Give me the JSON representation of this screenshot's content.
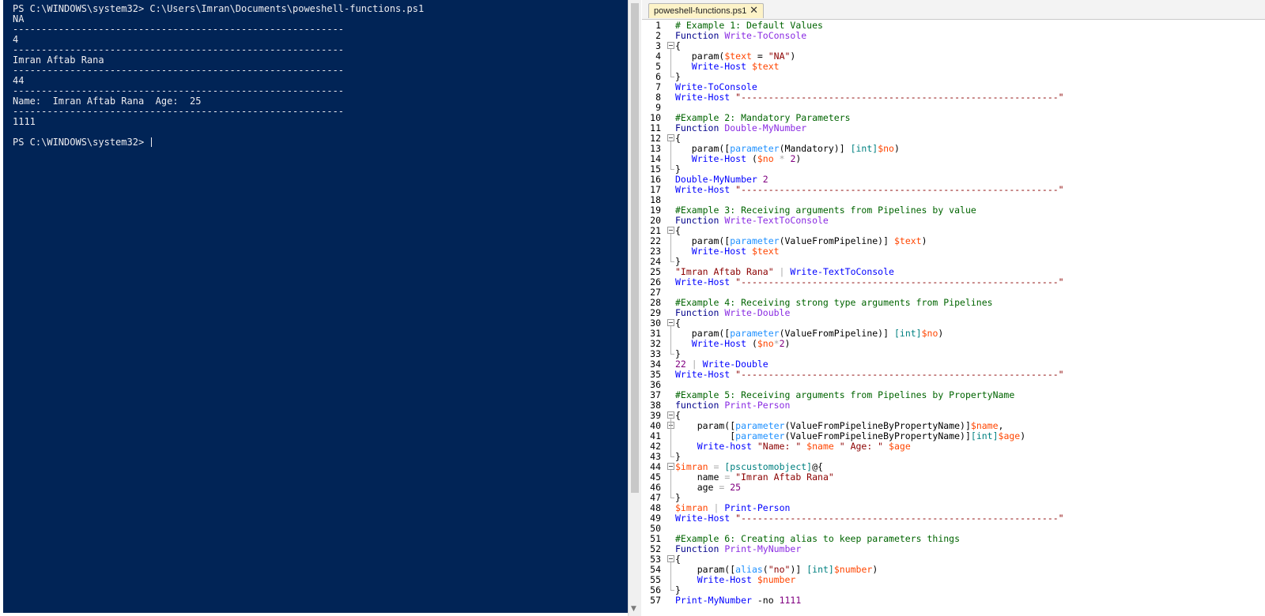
{
  "console": {
    "lines": [
      "PS C:\\WINDOWS\\system32> C:\\Users\\Imran\\Documents\\poweshell-functions.ps1",
      "NA",
      "----------------------------------------------------------",
      "4",
      "----------------------------------------------------------",
      "Imran Aftab Rana",
      "----------------------------------------------------------",
      "44",
      "----------------------------------------------------------",
      "Name:  Imran Aftab Rana  Age:  25",
      "----------------------------------------------------------",
      "1111",
      "",
      "PS C:\\WINDOWS\\system32> "
    ]
  },
  "editor": {
    "tab_label": "poweshell-functions.ps1",
    "close_glyph": "✕",
    "lines": [
      {
        "n": "1",
        "t": [
          [
            "cm",
            "# Example 1: Default Values"
          ]
        ]
      },
      {
        "n": "2",
        "t": [
          [
            "kw",
            "Function "
          ],
          [
            "fn",
            "Write-ToConsole"
          ]
        ]
      },
      {
        "n": "3",
        "t": [
          [
            "pl",
            "{"
          ]
        ]
      },
      {
        "n": "4",
        "t": [
          [
            "pl",
            "   param("
          ],
          [
            "va",
            "$text"
          ],
          [
            "pl",
            " = "
          ],
          [
            "st",
            "\"NA\""
          ],
          [
            "pl",
            ")"
          ]
        ]
      },
      {
        "n": "5",
        "t": [
          [
            "ge",
            "   Write-Host "
          ],
          [
            "va",
            "$text"
          ]
        ]
      },
      {
        "n": "6",
        "t": [
          [
            "pl",
            "}"
          ]
        ]
      },
      {
        "n": "7",
        "t": [
          [
            "ge",
            "Write-ToConsole"
          ]
        ]
      },
      {
        "n": "8",
        "t": [
          [
            "ge",
            "Write-Host "
          ],
          [
            "st",
            "\"----------------------------------------------------------\""
          ]
        ]
      },
      {
        "n": "9",
        "t": []
      },
      {
        "n": "10",
        "t": [
          [
            "cm",
            "#Example 2: Mandatory Parameters"
          ]
        ]
      },
      {
        "n": "11",
        "t": [
          [
            "kw",
            "Function "
          ],
          [
            "fn",
            "Double-MyNumber"
          ]
        ]
      },
      {
        "n": "12",
        "t": [
          [
            "pl",
            "{"
          ]
        ]
      },
      {
        "n": "13",
        "t": [
          [
            "pl",
            "   param(["
          ],
          [
            "at",
            "parameter"
          ],
          [
            "pl",
            "(Mandatory)] "
          ],
          [
            "ty",
            "[int]"
          ],
          [
            "va",
            "$no"
          ],
          [
            "pl",
            ")"
          ]
        ]
      },
      {
        "n": "14",
        "t": [
          [
            "ge",
            "   Write-Host "
          ],
          [
            "pl",
            "("
          ],
          [
            "va",
            "$no"
          ],
          [
            "op",
            " * "
          ],
          [
            "nu",
            "2"
          ],
          [
            "pl",
            ")"
          ]
        ]
      },
      {
        "n": "15",
        "t": [
          [
            "pl",
            "}"
          ]
        ]
      },
      {
        "n": "16",
        "t": [
          [
            "ge",
            "Double-MyNumber "
          ],
          [
            "nu",
            "2"
          ]
        ]
      },
      {
        "n": "17",
        "t": [
          [
            "ge",
            "Write-Host "
          ],
          [
            "st",
            "\"----------------------------------------------------------\""
          ]
        ]
      },
      {
        "n": "18",
        "t": []
      },
      {
        "n": "19",
        "t": [
          [
            "cm",
            "#Example 3: Receiving arguments from Pipelines by value"
          ]
        ]
      },
      {
        "n": "20",
        "t": [
          [
            "kw",
            "Function "
          ],
          [
            "fn",
            "Write-TextToConsole"
          ]
        ]
      },
      {
        "n": "21",
        "t": [
          [
            "pl",
            "{"
          ]
        ]
      },
      {
        "n": "22",
        "t": [
          [
            "pl",
            "   param(["
          ],
          [
            "at",
            "parameter"
          ],
          [
            "pl",
            "(ValueFromPipeline)] "
          ],
          [
            "va",
            "$text"
          ],
          [
            "pl",
            ")"
          ]
        ]
      },
      {
        "n": "23",
        "t": [
          [
            "ge",
            "   Write-Host "
          ],
          [
            "va",
            "$text"
          ]
        ]
      },
      {
        "n": "24",
        "t": [
          [
            "pl",
            "}"
          ]
        ]
      },
      {
        "n": "25",
        "t": [
          [
            "st",
            "\"Imran Aftab Rana\""
          ],
          [
            "op",
            " | "
          ],
          [
            "ge",
            "Write-TextToConsole"
          ]
        ]
      },
      {
        "n": "26",
        "t": [
          [
            "ge",
            "Write-Host "
          ],
          [
            "st",
            "\"----------------------------------------------------------\""
          ]
        ]
      },
      {
        "n": "27",
        "t": []
      },
      {
        "n": "28",
        "t": [
          [
            "cm",
            "#Example 4: Receiving strong type arguments from Pipelines"
          ]
        ]
      },
      {
        "n": "29",
        "t": [
          [
            "kw",
            "Function "
          ],
          [
            "fn",
            "Write-Double"
          ]
        ]
      },
      {
        "n": "30",
        "t": [
          [
            "pl",
            "{"
          ]
        ]
      },
      {
        "n": "31",
        "t": [
          [
            "pl",
            "   param(["
          ],
          [
            "at",
            "parameter"
          ],
          [
            "pl",
            "(ValueFromPipeline)] "
          ],
          [
            "ty",
            "[int]"
          ],
          [
            "va",
            "$no"
          ],
          [
            "pl",
            ")"
          ]
        ]
      },
      {
        "n": "32",
        "t": [
          [
            "ge",
            "   Write-Host "
          ],
          [
            "pl",
            "("
          ],
          [
            "va",
            "$no"
          ],
          [
            "op",
            "*"
          ],
          [
            "nu",
            "2"
          ],
          [
            "pl",
            ")"
          ]
        ]
      },
      {
        "n": "33",
        "t": [
          [
            "pl",
            "}"
          ]
        ]
      },
      {
        "n": "34",
        "t": [
          [
            "nu",
            "22"
          ],
          [
            "op",
            " | "
          ],
          [
            "ge",
            "Write-Double"
          ]
        ]
      },
      {
        "n": "35",
        "t": [
          [
            "ge",
            "Write-Host "
          ],
          [
            "st",
            "\"----------------------------------------------------------\""
          ]
        ]
      },
      {
        "n": "36",
        "t": []
      },
      {
        "n": "37",
        "t": [
          [
            "cm",
            "#Example 5: Receiving arguments from Pipelines by PropertyName"
          ]
        ]
      },
      {
        "n": "38",
        "t": [
          [
            "kw",
            "function "
          ],
          [
            "fn",
            "Print-Person"
          ]
        ]
      },
      {
        "n": "39",
        "t": [
          [
            "pl",
            "{"
          ]
        ]
      },
      {
        "n": "40",
        "t": [
          [
            "pl",
            "    param(["
          ],
          [
            "at",
            "parameter"
          ],
          [
            "pl",
            "(ValueFromPipelineByPropertyName)]"
          ],
          [
            "va",
            "$name"
          ],
          [
            "pl",
            ","
          ]
        ]
      },
      {
        "n": "41",
        "t": [
          [
            "pl",
            "          ["
          ],
          [
            "at",
            "parameter"
          ],
          [
            "pl",
            "(ValueFromPipelineByPropertyName)]"
          ],
          [
            "ty",
            "[int]"
          ],
          [
            "va",
            "$age"
          ],
          [
            "pl",
            ")"
          ]
        ]
      },
      {
        "n": "42",
        "t": [
          [
            "ge",
            "    Write-host "
          ],
          [
            "st",
            "\"Name: \" "
          ],
          [
            "va",
            "$name"
          ],
          [
            "st",
            " \" Age: \" "
          ],
          [
            "va",
            "$age"
          ]
        ]
      },
      {
        "n": "43",
        "t": [
          [
            "pl",
            "}"
          ]
        ]
      },
      {
        "n": "44",
        "t": [
          [
            "va",
            "$imran"
          ],
          [
            "op",
            " = "
          ],
          [
            "ty",
            "[pscustomobject]"
          ],
          [
            "pl",
            "@{"
          ]
        ]
      },
      {
        "n": "45",
        "t": [
          [
            "pl",
            "    name "
          ],
          [
            "op",
            "="
          ],
          [
            "st",
            " \"Imran Aftab Rana\""
          ]
        ]
      },
      {
        "n": "46",
        "t": [
          [
            "pl",
            "    age "
          ],
          [
            "op",
            "="
          ],
          [
            "nu",
            " 25"
          ]
        ]
      },
      {
        "n": "47",
        "t": [
          [
            "pl",
            "}"
          ]
        ]
      },
      {
        "n": "48",
        "t": [
          [
            "va",
            "$imran"
          ],
          [
            "op",
            " | "
          ],
          [
            "ge",
            "Print-Person"
          ]
        ]
      },
      {
        "n": "49",
        "t": [
          [
            "ge",
            "Write-Host "
          ],
          [
            "st",
            "\"----------------------------------------------------------\""
          ]
        ]
      },
      {
        "n": "50",
        "t": []
      },
      {
        "n": "51",
        "t": [
          [
            "cm",
            "#Example 6: Creating alias to keep parameters things"
          ]
        ]
      },
      {
        "n": "52",
        "t": [
          [
            "kw",
            "Function "
          ],
          [
            "fn",
            "Print-MyNumber"
          ]
        ]
      },
      {
        "n": "53",
        "t": [
          [
            "pl",
            "{"
          ]
        ]
      },
      {
        "n": "54",
        "t": [
          [
            "pl",
            "    param(["
          ],
          [
            "at",
            "alias"
          ],
          [
            "pl",
            "("
          ],
          [
            "st",
            "\"no\""
          ],
          [
            "pl",
            ")] "
          ],
          [
            "ty",
            "[int]"
          ],
          [
            "va",
            "$number"
          ],
          [
            "pl",
            ")"
          ]
        ]
      },
      {
        "n": "55",
        "t": [
          [
            "ge",
            "    Write-Host "
          ],
          [
            "va",
            "$number"
          ]
        ]
      },
      {
        "n": "56",
        "t": [
          [
            "pl",
            "}"
          ]
        ]
      },
      {
        "n": "57",
        "t": [
          [
            "ge",
            "Print-MyNumber "
          ],
          [
            "pl",
            "-no "
          ],
          [
            "nu",
            "1111"
          ]
        ]
      }
    ]
  }
}
